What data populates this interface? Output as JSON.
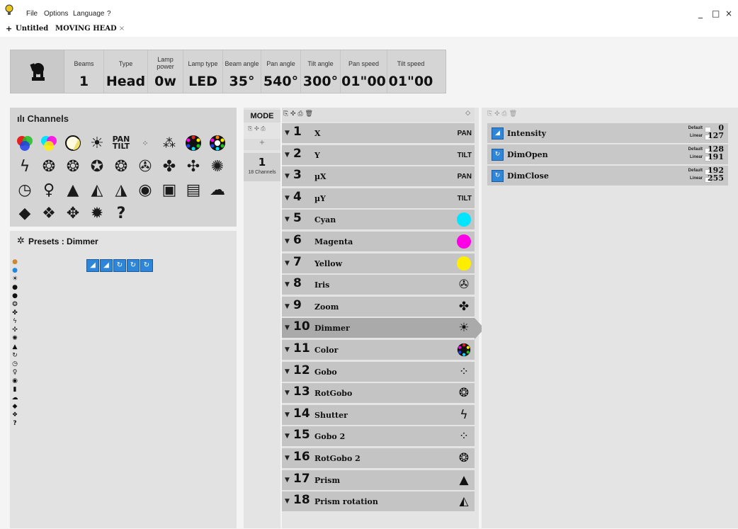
{
  "menu": {
    "file": "File",
    "options": "Options",
    "language": "Language",
    "help": "?"
  },
  "window": {
    "minimize": "_",
    "maximize": "□",
    "close": "×"
  },
  "tabs": {
    "add": "+",
    "items": [
      {
        "label": "Untitled"
      },
      {
        "label": "MOVING HEAD",
        "close": "×"
      }
    ]
  },
  "header": {
    "cells": [
      {
        "label": "Beams",
        "value": "1"
      },
      {
        "label": "Type",
        "value": "Head"
      },
      {
        "label": "Lamp power",
        "value": "0w"
      },
      {
        "label": "Lamp type",
        "value": "LED"
      },
      {
        "label": "Beam angle",
        "value": "35°"
      },
      {
        "label": "Pan angle",
        "value": "540°"
      },
      {
        "label": "Tilt angle",
        "value": "300°"
      },
      {
        "label": "Pan speed",
        "value": "01\"00"
      },
      {
        "label": "Tilt speed",
        "value": "01\"00"
      }
    ]
  },
  "channels_panel": {
    "icon": "ılı",
    "title": "Channels"
  },
  "presets_panel": {
    "title": "Presets : Dimmer"
  },
  "mode": {
    "label": "MODE",
    "add": "+",
    "item_number": "1",
    "item_sub": "18 Channels"
  },
  "list_toolbar": {
    "tools": "⎘ ✣ ⎙ 🗑",
    "sort": "◇"
  },
  "channels": [
    {
      "num": "1",
      "name": "X",
      "badge": "PAN"
    },
    {
      "num": "2",
      "name": "Y",
      "badge": "TILT"
    },
    {
      "num": "3",
      "name": "µX",
      "badge": "PAN"
    },
    {
      "num": "4",
      "name": "µY",
      "badge": "TILT"
    },
    {
      "num": "5",
      "name": "Cyan",
      "color": "#00e5ff"
    },
    {
      "num": "6",
      "name": "Magenta",
      "color": "#ff00e6"
    },
    {
      "num": "7",
      "name": "Yellow",
      "color": "#ffee00"
    },
    {
      "num": "8",
      "name": "Iris",
      "icon": "iris-icon"
    },
    {
      "num": "9",
      "name": "Zoom",
      "icon": "zoom-icon"
    },
    {
      "num": "10",
      "name": "Dimmer",
      "icon": "dimmer-icon",
      "active": true
    },
    {
      "num": "11",
      "name": "Color",
      "icon": "color-wheel-icon"
    },
    {
      "num": "12",
      "name": "Gobo",
      "icon": "gobo-icon"
    },
    {
      "num": "13",
      "name": "RotGobo",
      "icon": "rotgobo-icon"
    },
    {
      "num": "14",
      "name": "Shutter",
      "icon": "shutter-icon"
    },
    {
      "num": "15",
      "name": "Gobo 2",
      "icon": "gobo-icon"
    },
    {
      "num": "16",
      "name": "RotGobo 2",
      "icon": "rotgobo-icon"
    },
    {
      "num": "17",
      "name": "Prism",
      "icon": "prism-icon"
    },
    {
      "num": "18",
      "name": "Prism rotation",
      "icon": "prism-rotation-icon"
    }
  ],
  "capabilities": [
    {
      "name": "Intensity",
      "default_label": "Default",
      "linear_label": "Linear",
      "from": "0",
      "to": "127"
    },
    {
      "name": "DimOpen",
      "default_label": "Default",
      "linear_label": "Linear",
      "from": "128",
      "to": "191"
    },
    {
      "name": "DimClose",
      "default_label": "Default",
      "linear_label": "Linear",
      "from": "192",
      "to": "255"
    }
  ]
}
